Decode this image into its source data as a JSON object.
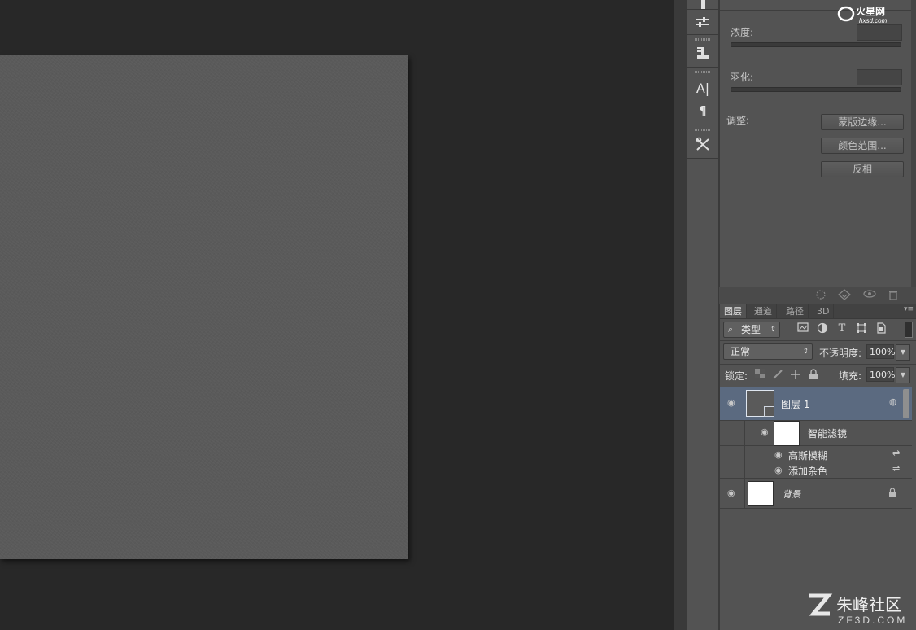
{
  "mask_panel": {
    "density_label": "浓度:",
    "feather_label": "羽化:",
    "adjust_label": "调整:",
    "buttons": {
      "mask_edge": "蒙版边缘...",
      "color_range": "颜色范围...",
      "invert": "反相"
    }
  },
  "layers_panel": {
    "tabs": [
      "图层",
      "通道",
      "路径",
      "3D"
    ],
    "filter_kind": "类型",
    "blend_mode": "正常",
    "opacity_label": "不透明度:",
    "opacity_value": "100%",
    "lock_label": "锁定:",
    "fill_label": "填充:",
    "fill_value": "100%",
    "layers": {
      "layer1_name": "图层 1",
      "smart_filters_label": "智能滤镜",
      "filters": [
        "高斯模糊",
        "添加杂色"
      ],
      "background_name": "背景"
    }
  },
  "watermarks": {
    "top_right_brand": "火星网",
    "top_right_url": "hxsd.com",
    "bottom_right_brand": "朱峰社区",
    "bottom_right_url": "ZF3D.COM"
  },
  "colors": {
    "canvas_fill": "#5a5a5a",
    "panel_bg": "#535353",
    "selected_layer": "#5b6a80",
    "app_bg": "#282828"
  },
  "icons": {
    "toolstrip": [
      "brush-icon",
      "adjustments-icon",
      "stamp-icon",
      "character-icon",
      "paragraph-icon",
      "tool-presets-icon"
    ],
    "mask_footer": [
      "load-selection-icon",
      "apply-mask-icon",
      "visibility-icon",
      "trash-icon"
    ],
    "filter_types": [
      "pixel-layer-filter-icon",
      "adjustment-filter-icon",
      "type-filter-icon",
      "shape-filter-icon",
      "smart-object-filter-icon"
    ],
    "locks": [
      "lock-transparent-icon",
      "lock-pixels-icon",
      "lock-position-icon",
      "lock-all-icon"
    ]
  }
}
